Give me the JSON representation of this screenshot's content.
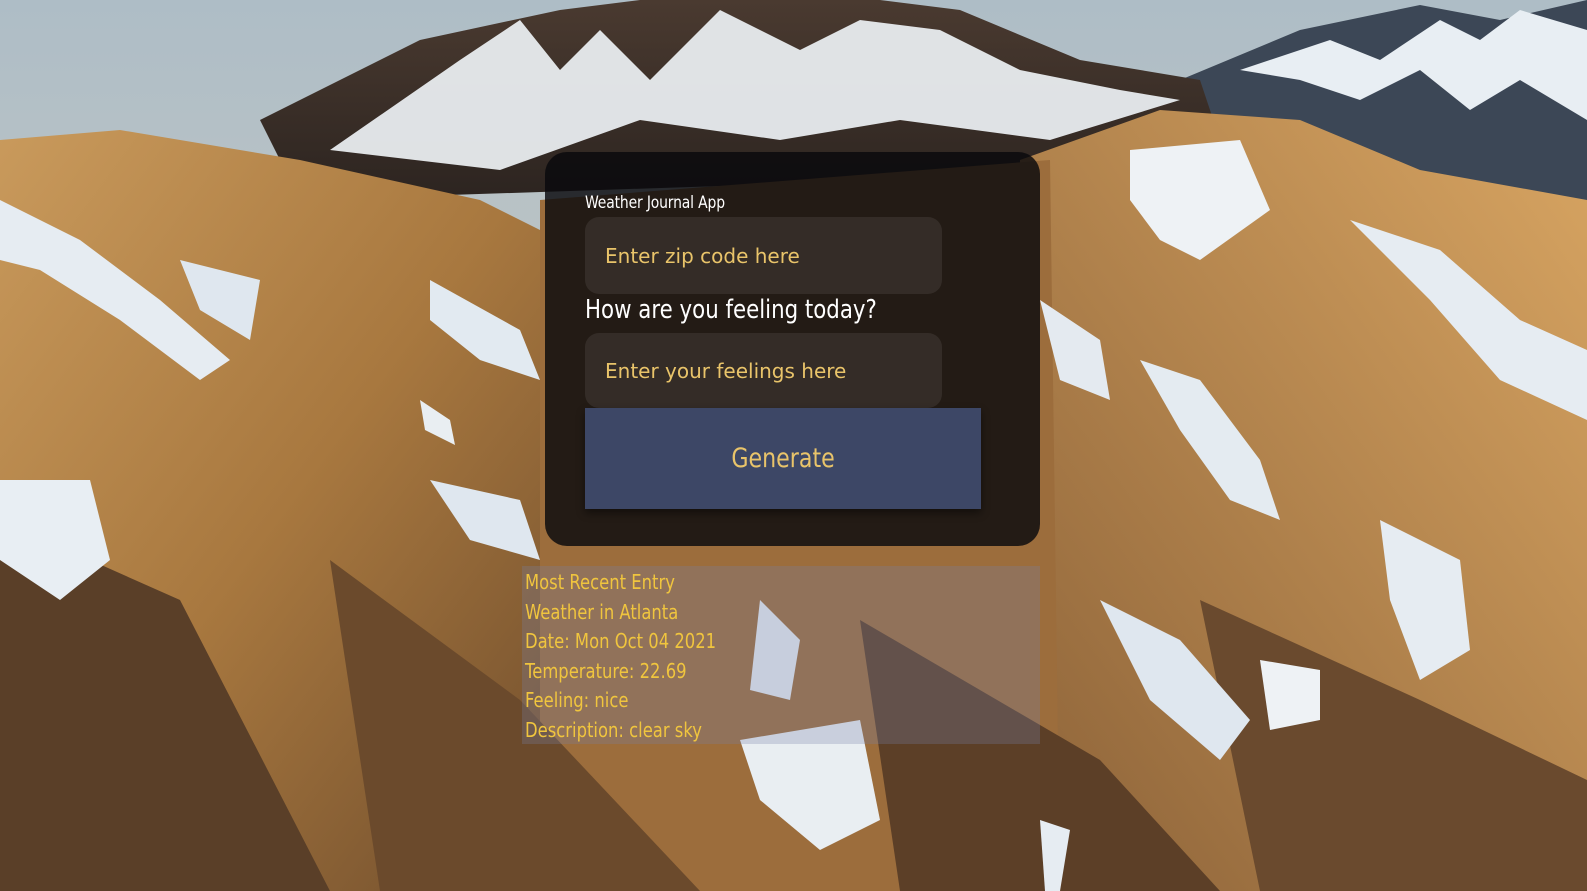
{
  "app": {
    "title": "Weather Journal App"
  },
  "form": {
    "zip_placeholder": "Enter zip code here",
    "feelings_label": "How are you feeling today?",
    "feelings_placeholder": "Enter your feelings here",
    "generate_label": "Generate"
  },
  "entry": {
    "heading": "Most Recent Entry",
    "location": "Weather in Atlanta",
    "date": "Date: Mon Oct 04 2021",
    "temperature": "Temperature: 22.69",
    "feeling": "Feeling: nice",
    "description": "Description: clear sky"
  },
  "colors": {
    "accent_text": "#e9c46a",
    "button_bg": "#3d4766",
    "card_bg": "#0a0a0e"
  }
}
